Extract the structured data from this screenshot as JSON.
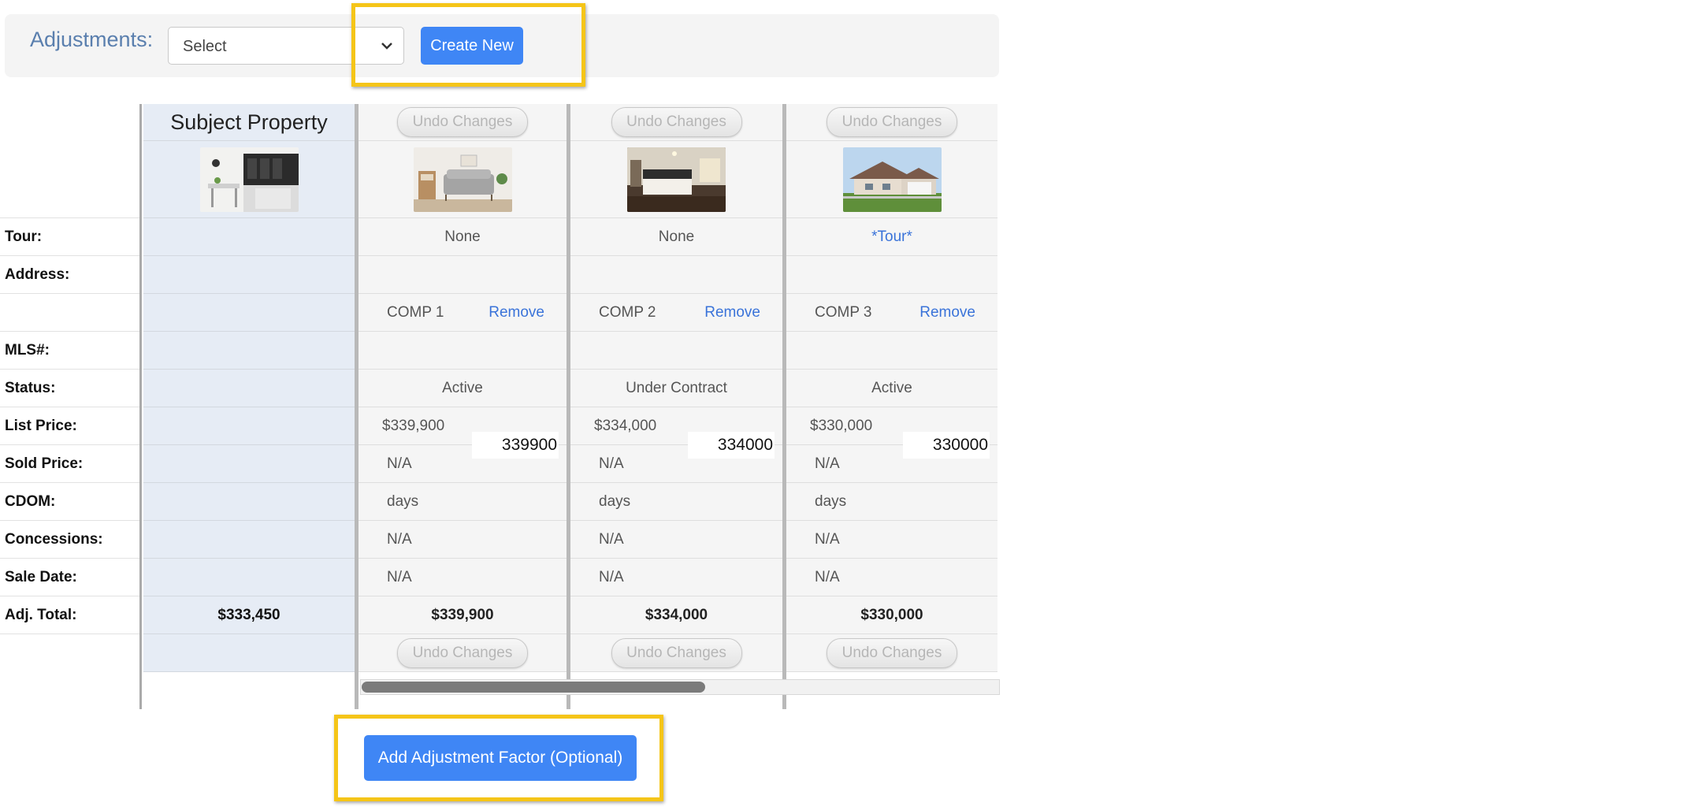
{
  "toolbar": {
    "adjustments_label": "Adjustments:",
    "select_value": "Select",
    "create_label": "Create New"
  },
  "subject": {
    "title": "Subject Property",
    "adj_total": "$333,450"
  },
  "row_labels": {
    "tour": "Tour:",
    "address": "Address:",
    "mls": "MLS#:",
    "status": "Status:",
    "list_price": "List Price:",
    "sold_price": "Sold Price:",
    "cdom": "CDOM:",
    "concessions": "Concessions:",
    "sale_date": "Sale Date:",
    "adj_total": "Adj. Total:"
  },
  "comps": [
    {
      "undo_label": "Undo Changes",
      "tour": "None",
      "comp_label": "COMP 1",
      "remove_label": "Remove",
      "status": "Active",
      "list_price": "$339,900",
      "price_input": "339900",
      "sold_price": "N/A",
      "cdom": "days",
      "concessions": "N/A",
      "sale_date": "N/A",
      "adj_total": "$339,900",
      "photo": "living-room-photo"
    },
    {
      "undo_label": "Undo Changes",
      "tour": "None",
      "comp_label": "COMP 2",
      "remove_label": "Remove",
      "status": "Under Contract",
      "list_price": "$334,000",
      "price_input": "334000",
      "sold_price": "N/A",
      "cdom": "days",
      "concessions": "N/A",
      "sale_date": "N/A",
      "adj_total": "$334,000",
      "photo": "bedroom-photo"
    },
    {
      "undo_label": "Undo Changes",
      "tour": "*Tour*",
      "comp_label": "COMP 3",
      "remove_label": "Remove",
      "status": "Active",
      "list_price": "$330,000",
      "price_input": "330000",
      "sold_price": "N/A",
      "cdom": "days",
      "concessions": "N/A",
      "sale_date": "N/A",
      "adj_total": "$330,000",
      "photo": "house-exterior-photo"
    }
  ],
  "footer": {
    "add_factor_label": "Add Adjustment Factor (Optional)"
  },
  "scrollbar": {
    "visible_fraction": 0.54
  },
  "colors": {
    "primary": "#3f86f5",
    "highlight": "#f5c518",
    "link": "#3a73d9",
    "subject_bg": "#e6ecf5"
  }
}
